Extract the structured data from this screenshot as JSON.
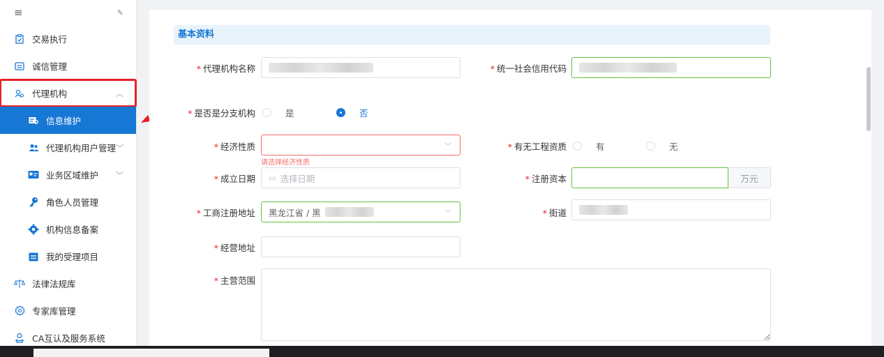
{
  "sidebar": {
    "menu_icon": "≡",
    "pin_icon": "📌",
    "items": [
      {
        "label": "交易执行"
      },
      {
        "label": "诚信管理"
      },
      {
        "label": "代理机构"
      },
      {
        "label": "信息维护"
      },
      {
        "label": "代理机构用户管理"
      },
      {
        "label": "业务区域维护"
      },
      {
        "label": "角色人员管理"
      },
      {
        "label": "机构信息备案"
      },
      {
        "label": "我的受理项目"
      },
      {
        "label": "法律法规库"
      },
      {
        "label": "专家库管理"
      },
      {
        "label": "CA互认及服务系统"
      }
    ]
  },
  "form": {
    "section_title": "基本资料",
    "agency_name_label": "代理机构名称",
    "credit_code_label": "统一社会信用代码",
    "is_branch_label": "是否是分支机构",
    "branch_yes": "是",
    "branch_no": "否",
    "economic_nature_label": "经济性质",
    "economic_nature_error": "请选择经济性质",
    "qualification_label": "有无工程资质",
    "qual_yes": "有",
    "qual_no": "无",
    "establish_date_label": "成立日期",
    "establish_date_placeholder": "选择日期",
    "registered_capital_label": "注册资本",
    "capital_unit": "万元",
    "reg_address_label": "工商注册地址",
    "reg_address_value": "黑龙江省 / 黑",
    "street_label": "街道",
    "biz_address_label": "经营地址",
    "biz_scope_label": "主营范围"
  },
  "colors": {
    "accent": "#1677d4",
    "error": "#f56c6c",
    "valid": "#67c23a",
    "annotation": "#e8212a"
  }
}
